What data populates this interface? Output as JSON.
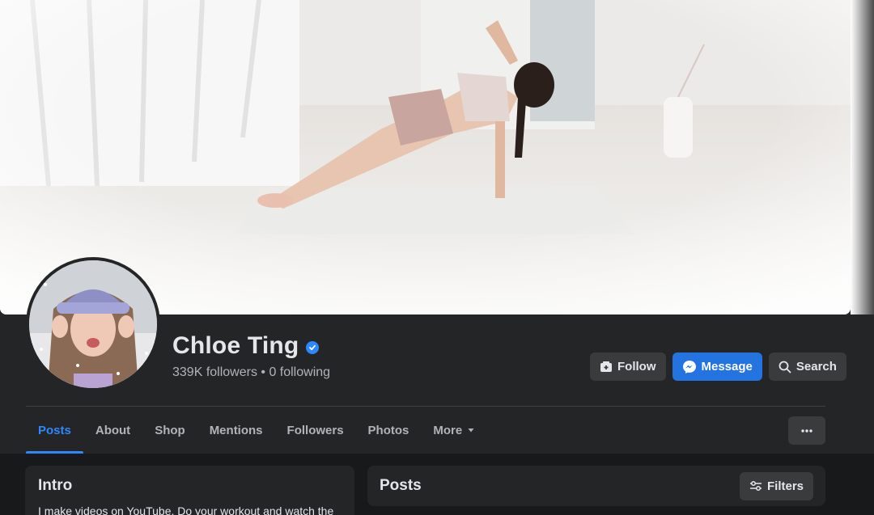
{
  "profile": {
    "name": "Chloe Ting",
    "stats": "339K followers • 0 following",
    "verified_icon": "verified-badge-icon"
  },
  "actions": {
    "follow_label": "Follow",
    "message_label": "Message",
    "search_label": "Search"
  },
  "tabs": [
    {
      "label": "Posts",
      "active": true
    },
    {
      "label": "About"
    },
    {
      "label": "Shop"
    },
    {
      "label": "Mentions"
    },
    {
      "label": "Followers"
    },
    {
      "label": "Photos"
    },
    {
      "label": "More"
    }
  ],
  "intro": {
    "title": "Intro",
    "text": "I make videos on YouTube. Do your workout and watch the"
  },
  "posts": {
    "title": "Posts",
    "filters_label": "Filters"
  },
  "colors": {
    "accent": "#2d88ff",
    "primary_button": "#2374e1",
    "surface": "#242526",
    "background": "#18191a"
  }
}
